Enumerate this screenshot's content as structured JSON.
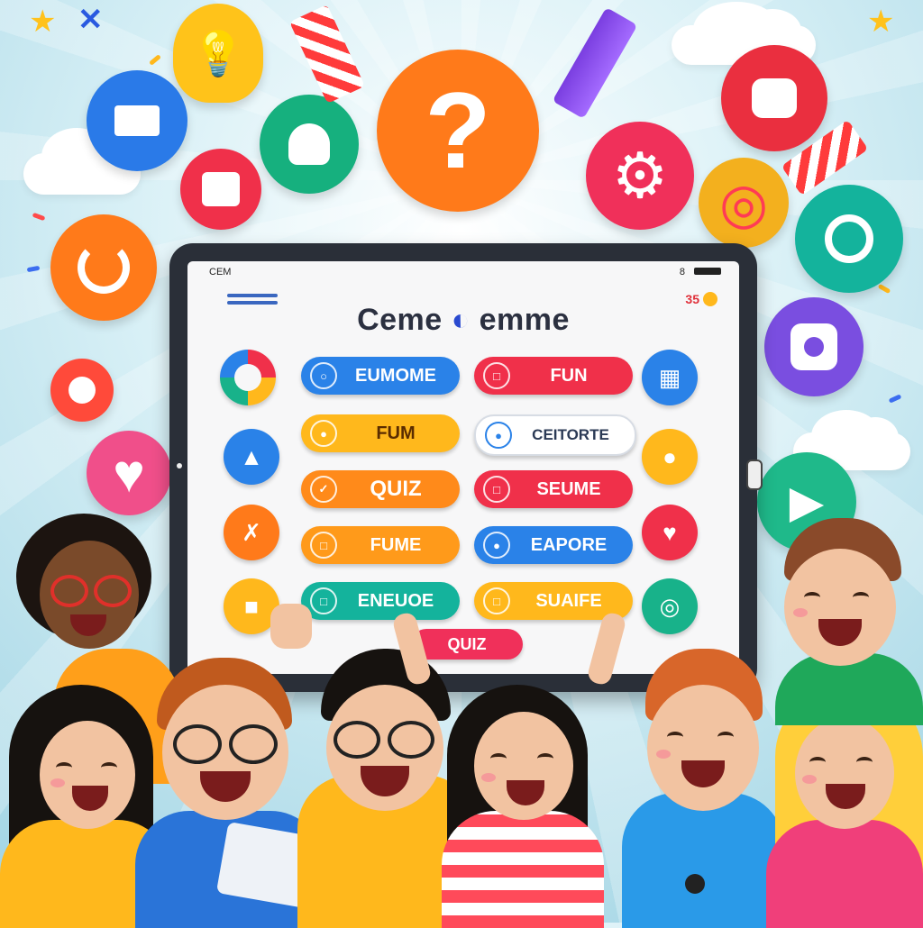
{
  "screen": {
    "status_left": "CEM",
    "status_right": "8",
    "title": "Ceme",
    "title_mid": "◐",
    "title_end": "emme",
    "badge": "35"
  },
  "buttons": {
    "row1_left": "EUMOME",
    "row1_right": "FUN",
    "row2_left": "FUM",
    "row2_right": "CEITORTE",
    "row3_left": "QUIZ",
    "row3_right": "SEUME",
    "row4_left": "FUME",
    "row4_right": "EAPORE",
    "row5_left": "ENEUOE",
    "row5_right": "SUAIFE",
    "bottom": "QUIZ"
  },
  "icons": {
    "question": "?",
    "heart": "♥",
    "gear": "⚙",
    "play": "▶",
    "target": "◎",
    "bulb": "◉"
  },
  "colors": {
    "orange": "#ff7a1a",
    "red": "#f0304a",
    "blue": "#2a82e8",
    "green": "#18b28a",
    "yellow": "#ffb81c",
    "purple": "#7a4ee0",
    "pink": "#f04f8a",
    "teal": "#14b39c"
  }
}
